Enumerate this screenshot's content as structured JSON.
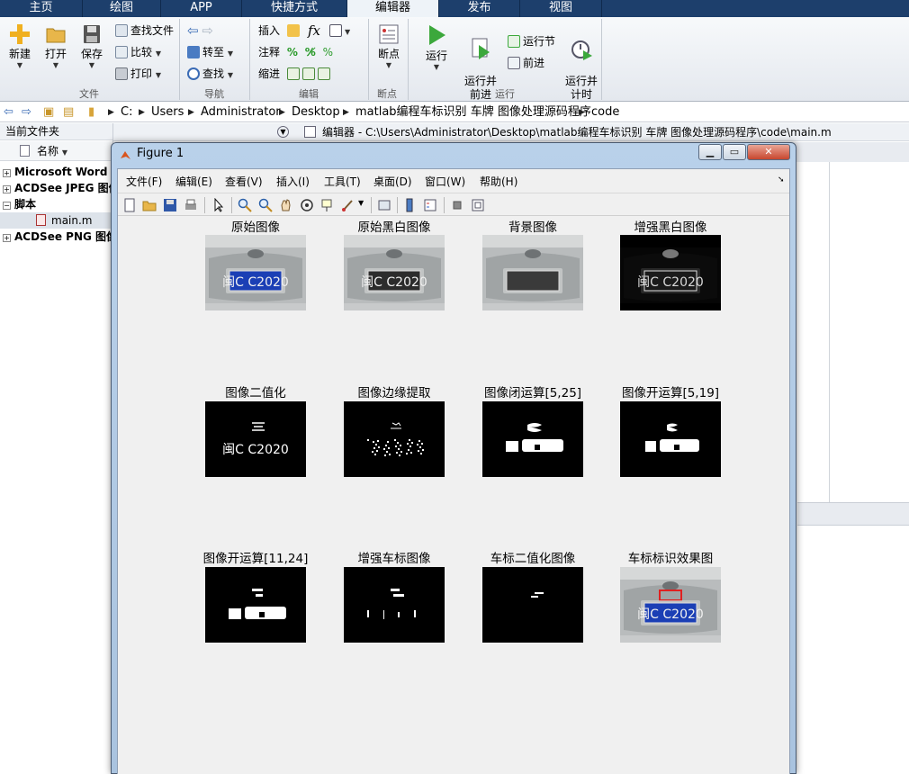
{
  "tabs": [
    "主页",
    "绘图",
    "APP",
    "快捷方式",
    "编辑器",
    "发布",
    "视图"
  ],
  "ribbon": {
    "file": {
      "new": "新建",
      "open": "打开",
      "save": "保存",
      "find_files": "查找文件",
      "compare": "比较",
      "print": "打印",
      "group": "文件"
    },
    "nav": {
      "goto": "转至",
      "find": "查找",
      "group": "导航"
    },
    "edit": {
      "insert": "插入",
      "comment": "注释",
      "indent": "缩进",
      "fx": "fx",
      "group": "编辑"
    },
    "breakpoint": {
      "label": "断点",
      "group": "断点"
    },
    "run": {
      "run": "运行",
      "run_advance": "运行并\n前进",
      "run_section": "运行节",
      "advance": "前进",
      "run_time": "运行并\n计时",
      "group": "运行"
    }
  },
  "address": {
    "crumbs": [
      "C:",
      "Users",
      "Administrator",
      "Desktop",
      "matlab编程车标识别 车牌 图像处理源码程序",
      "code"
    ]
  },
  "left_panel": {
    "title": "当前文件夹",
    "header": "名称",
    "rows": [
      {
        "label": "Microsoft Word S",
        "expander": "+"
      },
      {
        "label": "ACDSee JPEG 图像",
        "expander": "+"
      },
      {
        "label": "脚本",
        "expander": "−"
      },
      {
        "label": "main.m",
        "expander": ""
      },
      {
        "label": "ACDSee PNG 图像",
        "expander": "+"
      }
    ]
  },
  "editor": {
    "title": "编辑器 - C:\\Users\\Administrator\\Desktop\\matlab编程车标识别 车牌 图像处理源码程序\\code\\main.m"
  },
  "figure": {
    "title": "Figure 1",
    "menu": [
      "文件(F)",
      "编辑(E)",
      "查看(V)",
      "插入(I)",
      "工具(T)",
      "桌面(D)",
      "窗口(W)",
      "帮助(H)"
    ],
    "subplots": [
      {
        "title": "原始图像",
        "kind": "car-color"
      },
      {
        "title": "原始黑白图像",
        "kind": "car-gray"
      },
      {
        "title": "背景图像",
        "kind": "car-bg"
      },
      {
        "title": "增强黑白图像",
        "kind": "car-enhanced"
      },
      {
        "title": "图像二值化",
        "kind": "bin-text"
      },
      {
        "title": "图像边缘提取",
        "kind": "bin-edge"
      },
      {
        "title": "图像闭运算[5,25]",
        "kind": "bin-close"
      },
      {
        "title": "图像开运算[5,19]",
        "kind": "bin-open"
      },
      {
        "title": "图像开运算[11,24]",
        "kind": "bin-open2"
      },
      {
        "title": "增强车标图像",
        "kind": "bin-logo"
      },
      {
        "title": "车标二值化图像",
        "kind": "bin-logo2"
      },
      {
        "title": "车标标识效果图",
        "kind": "car-marked"
      }
    ],
    "plate_text": "闽C C2020"
  },
  "colors": {
    "tabbar": "#1d3f6c",
    "plate_blue": "#1b3fb5",
    "mark_red": "#e02020"
  }
}
